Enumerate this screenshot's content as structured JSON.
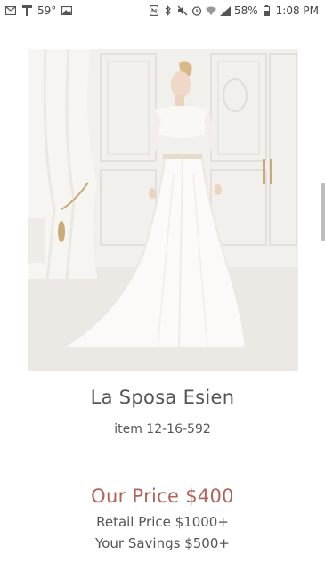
{
  "status_bar": {
    "temperature": "59°",
    "battery_percent": "58%",
    "time": "1:08 PM",
    "left_icons": [
      "mail-icon",
      "t-mobile-icon",
      "image-icon"
    ],
    "right_icons": [
      "nfc-icon",
      "bluetooth-icon",
      "mute-icon",
      "alarm-icon",
      "wifi-icon",
      "signal-icon",
      "battery-icon"
    ]
  },
  "product": {
    "image_alt": "bridal gown",
    "name": "La Sposa Esien",
    "item_number": "item 12-16-592",
    "our_price": "Our Price $400",
    "retail_price": "Retail Price $1000+",
    "savings": "Your Savings $500+"
  },
  "colors": {
    "price_accent": "#b0645a",
    "text": "#555555",
    "background": "#ffffff"
  }
}
